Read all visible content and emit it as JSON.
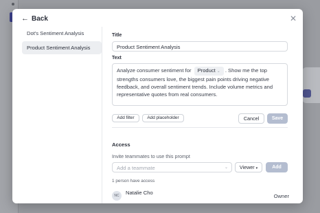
{
  "header": {
    "back_label": "Back"
  },
  "sidebar": {
    "items": [
      {
        "label": "Dot's Sentiment Analysis"
      },
      {
        "label": "Product Sentiment Analysis"
      }
    ]
  },
  "form": {
    "title_label": "Title",
    "title_value": "Product Sentiment Analysis",
    "text_label": "Text",
    "text_before": "Analyze consumer sentiment for",
    "filter_chip": "Product",
    "text_after": ". Show me the top strengths consumers love, the biggest pain points driving negative feedback, and overall sentiment trends. Include volume metrics and representative quotes from real consumers.",
    "add_filter_label": "Add filter",
    "add_placeholder_label": "Add placeholder",
    "cancel_label": "Cancel",
    "save_label": "Save"
  },
  "access": {
    "title": "Access",
    "invite_text": "Invite teammates to use this prompt",
    "teammate_placeholder": "Add a teammate",
    "role_label": "Viewer",
    "add_label": "Add",
    "count_text": "1 person have access",
    "people": [
      {
        "initials": "NC",
        "name": "Natalie Cho",
        "role": "Owner"
      }
    ]
  },
  "colors": {
    "primary_disabled": "#b4bdd0",
    "active_bg": "#eceef1"
  }
}
